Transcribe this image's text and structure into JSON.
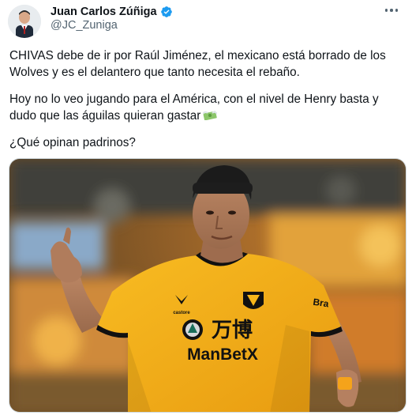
{
  "author": {
    "name": "Juan Carlos Zúñiga",
    "handle": "@JC_Zuniga",
    "verified_color": "#1d9bf0"
  },
  "tweet": {
    "paragraph1_line1": "CHIVAS debe de ir por Raúl Jiménez, el mexicano está borrado de los",
    "paragraph1_line2": "Wolves y es el delantero que tanto necesita el rebaño.",
    "paragraph2_line1": "Hoy no lo veo jugando para el América, con el nivel de Henry basta y",
    "paragraph2_line2": "dudo que las águilas quieran gastar",
    "paragraph2_emoji": "money-with-wings-emoji",
    "paragraph3": "¿Qué opinan padrinos?"
  },
  "media": {
    "description_icon": "player-photo",
    "jersey_sponsor_main": "ManBetX",
    "jersey_sponsor_cn": "万博",
    "jersey_kit_brand": "castore",
    "jersey_sleeve": "Bra",
    "jersey_color": "#f7b61a"
  },
  "icons": {
    "more": "more-options-icon",
    "verified": "verified-badge-icon"
  }
}
